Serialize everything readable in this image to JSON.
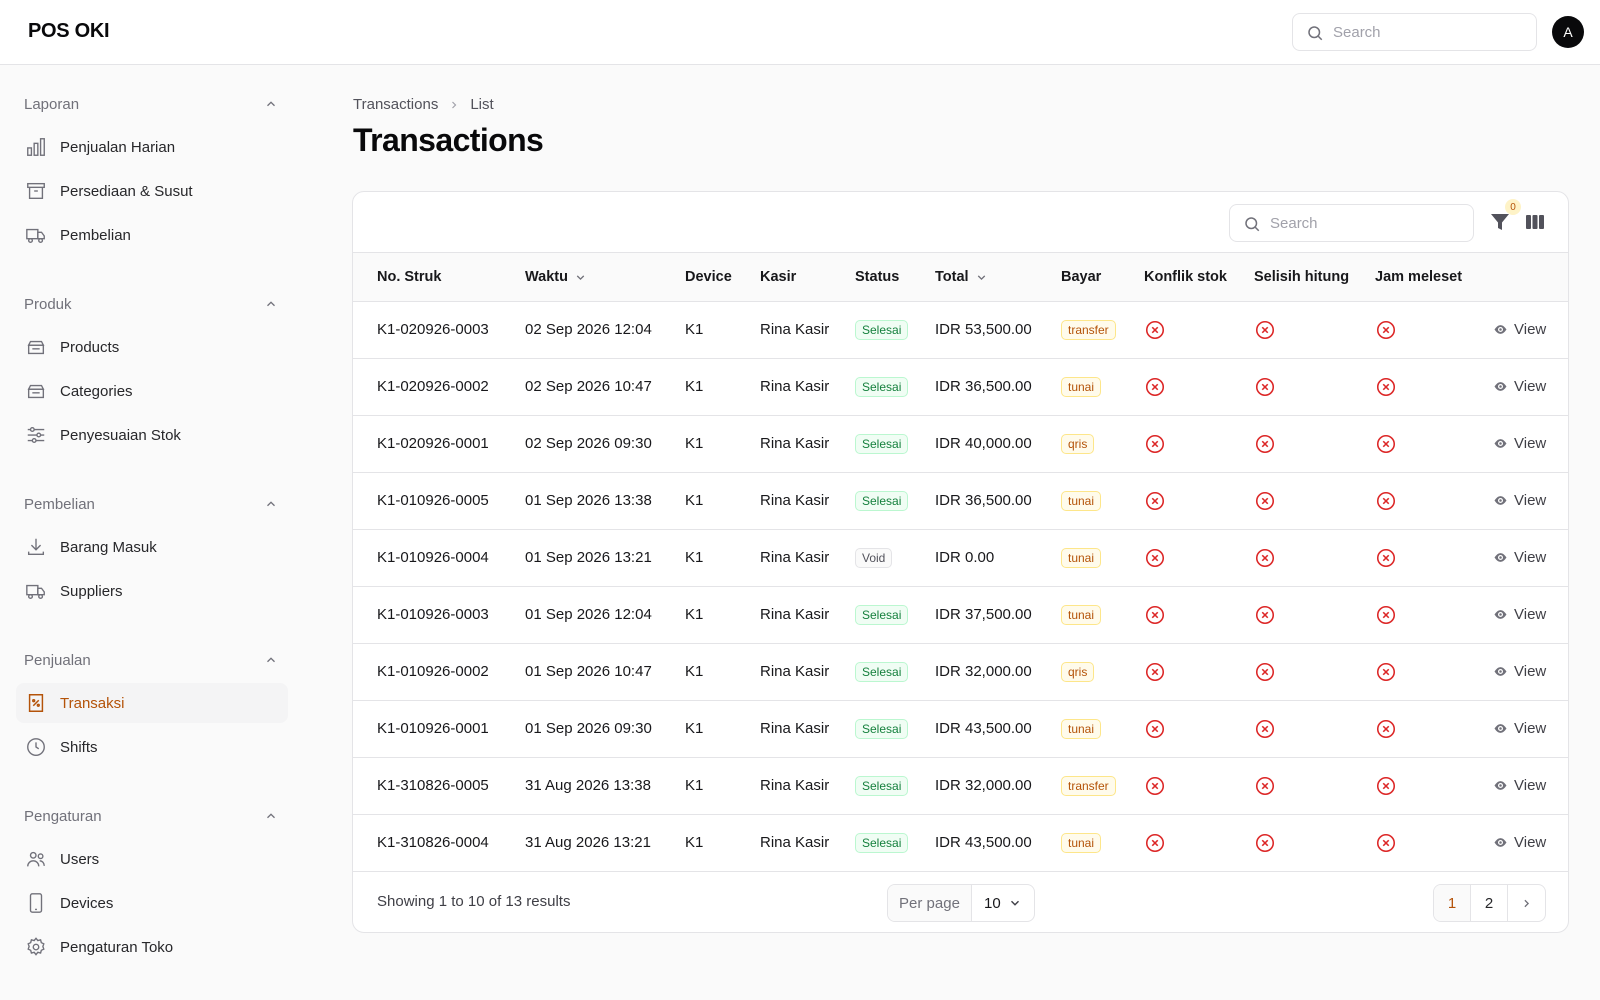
{
  "app": {
    "brand": "POS OKI",
    "search_placeholder": "Search",
    "avatar_initial": "A"
  },
  "sidebar": {
    "groups": [
      {
        "label": "Laporan",
        "items": [
          {
            "label": "Penjualan Harian",
            "icon": "bar-chart-icon"
          },
          {
            "label": "Persediaan & Susut",
            "icon": "archive-icon"
          },
          {
            "label": "Pembelian",
            "icon": "truck-icon"
          }
        ]
      },
      {
        "label": "Produk",
        "items": [
          {
            "label": "Products",
            "icon": "inbox-stack-icon"
          },
          {
            "label": "Categories",
            "icon": "inbox-stack-icon"
          },
          {
            "label": "Penyesuaian Stok",
            "icon": "sliders-icon"
          }
        ]
      },
      {
        "label": "Pembelian",
        "items": [
          {
            "label": "Barang Masuk",
            "icon": "download-icon"
          },
          {
            "label": "Suppliers",
            "icon": "truck-icon"
          }
        ]
      },
      {
        "label": "Penjualan",
        "items": [
          {
            "label": "Transaksi",
            "icon": "receipt-icon",
            "active": true
          },
          {
            "label": "Shifts",
            "icon": "clock-icon"
          }
        ]
      },
      {
        "label": "Pengaturan",
        "items": [
          {
            "label": "Users",
            "icon": "users-icon"
          },
          {
            "label": "Devices",
            "icon": "device-tablet-icon"
          },
          {
            "label": "Pengaturan Toko",
            "icon": "gear-icon"
          }
        ]
      }
    ]
  },
  "breadcrumb": [
    "Transactions",
    "List"
  ],
  "page_title": "Transactions",
  "table": {
    "search_placeholder": "Search",
    "filter_count": "0",
    "columns": [
      "No. Struk",
      "Waktu",
      "Device",
      "Kasir",
      "Status",
      "Total",
      "Bayar",
      "Konflik stok",
      "Selisih hitung",
      "Jam meleset"
    ],
    "view_label": "View",
    "rows": [
      {
        "no": "K1-020926-0003",
        "waktu": "02 Sep 2026 12:04",
        "device": "K1",
        "kasir": "Rina Kasir",
        "status": "Selesai",
        "total": "IDR 53,500.00",
        "bayar": "transfer"
      },
      {
        "no": "K1-020926-0002",
        "waktu": "02 Sep 2026 10:47",
        "device": "K1",
        "kasir": "Rina Kasir",
        "status": "Selesai",
        "total": "IDR 36,500.00",
        "bayar": "tunai"
      },
      {
        "no": "K1-020926-0001",
        "waktu": "02 Sep 2026 09:30",
        "device": "K1",
        "kasir": "Rina Kasir",
        "status": "Selesai",
        "total": "IDR 40,000.00",
        "bayar": "qris"
      },
      {
        "no": "K1-010926-0005",
        "waktu": "01 Sep 2026 13:38",
        "device": "K1",
        "kasir": "Rina Kasir",
        "status": "Selesai",
        "total": "IDR 36,500.00",
        "bayar": "tunai"
      },
      {
        "no": "K1-010926-0004",
        "waktu": "01 Sep 2026 13:21",
        "device": "K1",
        "kasir": "Rina Kasir",
        "status": "Void",
        "total": "IDR 0.00",
        "bayar": "tunai"
      },
      {
        "no": "K1-010926-0003",
        "waktu": "01 Sep 2026 12:04",
        "device": "K1",
        "kasir": "Rina Kasir",
        "status": "Selesai",
        "total": "IDR 37,500.00",
        "bayar": "tunai"
      },
      {
        "no": "K1-010926-0002",
        "waktu": "01 Sep 2026 10:47",
        "device": "K1",
        "kasir": "Rina Kasir",
        "status": "Selesai",
        "total": "IDR 32,000.00",
        "bayar": "qris"
      },
      {
        "no": "K1-010926-0001",
        "waktu": "01 Sep 2026 09:30",
        "device": "K1",
        "kasir": "Rina Kasir",
        "status": "Selesai",
        "total": "IDR 43,500.00",
        "bayar": "tunai"
      },
      {
        "no": "K1-310826-0005",
        "waktu": "31 Aug 2026 13:38",
        "device": "K1",
        "kasir": "Rina Kasir",
        "status": "Selesai",
        "total": "IDR 32,000.00",
        "bayar": "transfer"
      },
      {
        "no": "K1-310826-0004",
        "waktu": "31 Aug 2026 13:21",
        "device": "K1",
        "kasir": "Rina Kasir",
        "status": "Selesai",
        "total": "IDR 43,500.00",
        "bayar": "tunai"
      }
    ]
  },
  "footer": {
    "showing": "Showing 1 to 10 of 13 results",
    "per_page_label": "Per page",
    "per_page_value": "10",
    "pages": [
      "1",
      "2"
    ],
    "current_page": "1"
  },
  "colors": {
    "accent": "#b45309",
    "danger": "#dc2626",
    "success": "#15803d"
  }
}
